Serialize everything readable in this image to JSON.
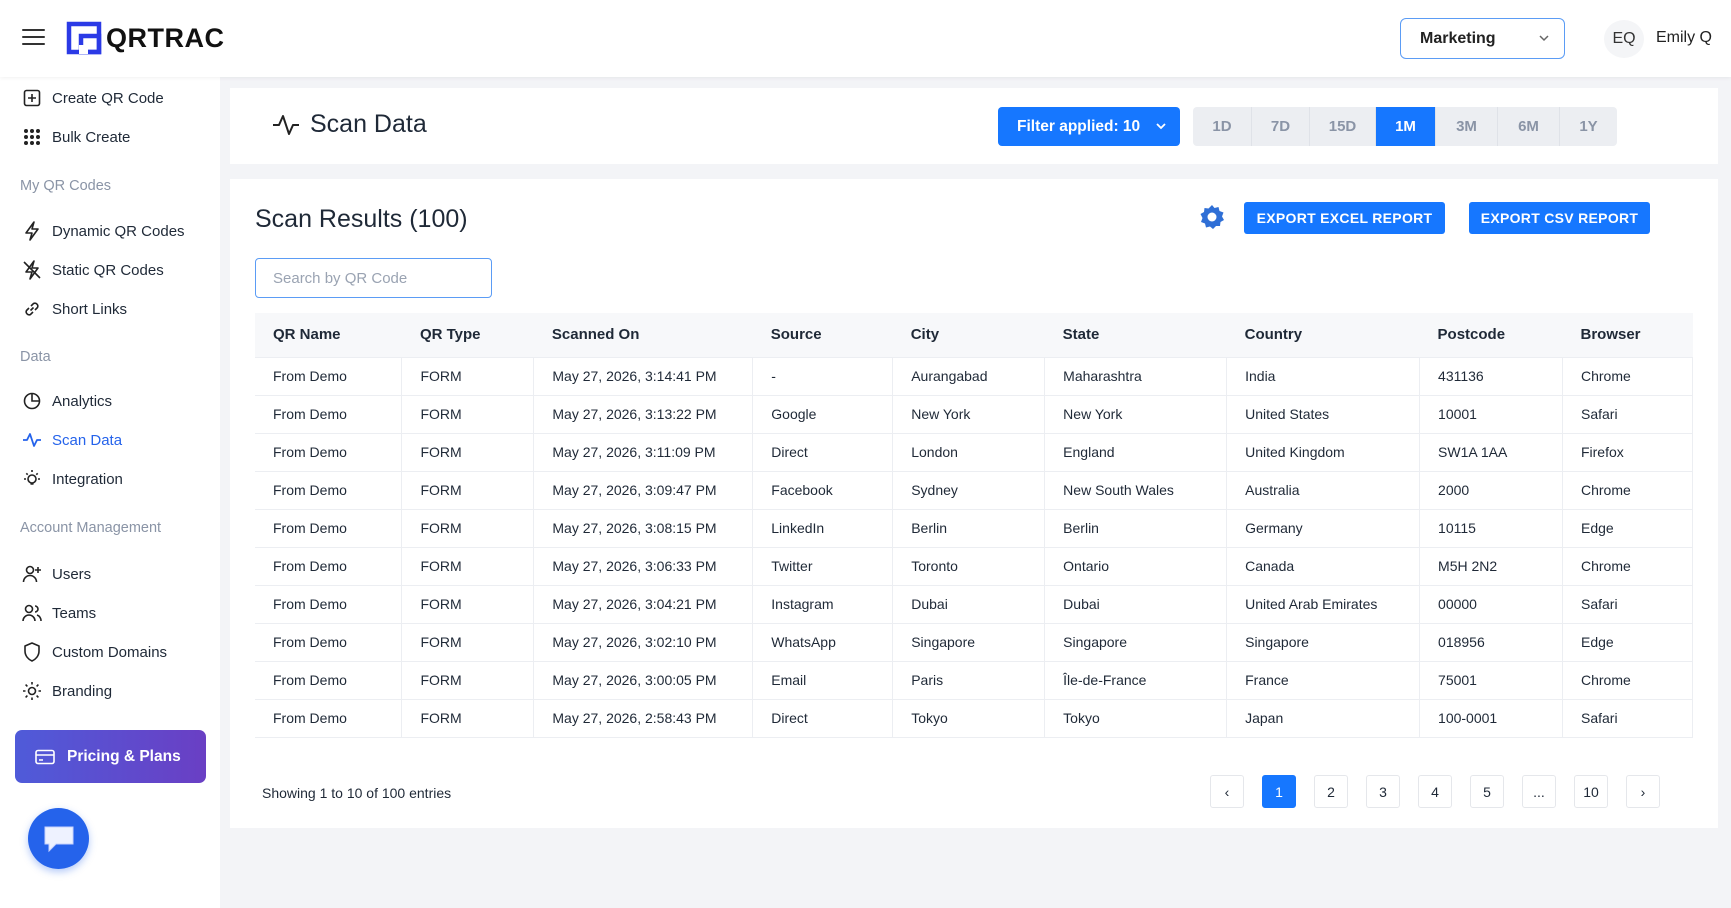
{
  "header": {
    "brand": "QRTRAC",
    "team": "Marketing",
    "avatar_initials": "EQ",
    "user_name": "Emily Q"
  },
  "sidebar": {
    "top_items": [
      {
        "label": "Create QR Code",
        "icon": "plus-square-icon"
      },
      {
        "label": "Bulk Create",
        "icon": "grid-dots-icon"
      }
    ],
    "sections": [
      {
        "label": "My QR Codes",
        "items": [
          {
            "label": "Dynamic QR Codes",
            "icon": "bolt-icon"
          },
          {
            "label": "Static QR Codes",
            "icon": "bolt-off-icon"
          },
          {
            "label": "Short Links",
            "icon": "link-icon"
          }
        ]
      },
      {
        "label": "Data",
        "items": [
          {
            "label": "Analytics",
            "icon": "pie-chart-icon"
          },
          {
            "label": "Scan Data",
            "icon": "activity-icon",
            "active": true
          },
          {
            "label": "Integration",
            "icon": "bulb-icon"
          }
        ]
      },
      {
        "label": "Account Management",
        "items": [
          {
            "label": "Users",
            "icon": "user-plus-icon"
          },
          {
            "label": "Teams",
            "icon": "users-icon"
          },
          {
            "label": "Custom Domains",
            "icon": "shield-icon"
          },
          {
            "label": "Branding",
            "icon": "sun-icon"
          }
        ]
      }
    ],
    "pricing_label": "Pricing & Plans"
  },
  "scan_header": {
    "title": "Scan Data",
    "filter_label": "Filter applied: 10",
    "ranges": [
      "1D",
      "7D",
      "15D",
      "1M",
      "3M",
      "6M",
      "1Y"
    ],
    "active_range": "1M"
  },
  "results": {
    "title": "Scan Results (100)",
    "export_excel": "EXPORT EXCEL REPORT",
    "export_csv": "EXPORT CSV REPORT",
    "search_placeholder": "Search by QR Code",
    "columns": [
      "QR Name",
      "QR Type",
      "Scanned On",
      "Source",
      "City",
      "State",
      "Country",
      "Postcode",
      "Browser"
    ],
    "rows": [
      [
        "From Demo",
        "FORM",
        "May 27, 2026, 3:14:41 PM",
        "-",
        "Aurangabad",
        "Maharashtra",
        "India",
        "431136",
        "Chrome"
      ],
      [
        "From Demo",
        "FORM",
        "May 27, 2026, 3:13:22 PM",
        "Google",
        "New York",
        "New York",
        "United States",
        "10001",
        "Safari"
      ],
      [
        "From Demo",
        "FORM",
        "May 27, 2026, 3:11:09 PM",
        "Direct",
        "London",
        "England",
        "United Kingdom",
        "SW1A 1AA",
        "Firefox"
      ],
      [
        "From Demo",
        "FORM",
        "May 27, 2026, 3:09:47 PM",
        "Facebook",
        "Sydney",
        "New South Wales",
        "Australia",
        "2000",
        "Chrome"
      ],
      [
        "From Demo",
        "FORM",
        "May 27, 2026, 3:08:15 PM",
        "LinkedIn",
        "Berlin",
        "Berlin",
        "Germany",
        "10115",
        "Edge"
      ],
      [
        "From Demo",
        "FORM",
        "May 27, 2026, 3:06:33 PM",
        "Twitter",
        "Toronto",
        "Ontario",
        "Canada",
        "M5H 2N2",
        "Chrome"
      ],
      [
        "From Demo",
        "FORM",
        "May 27, 2026, 3:04:21 PM",
        "Instagram",
        "Dubai",
        "Dubai",
        "United Arab Emirates",
        "00000",
        "Safari"
      ],
      [
        "From Demo",
        "FORM",
        "May 27, 2026, 3:02:10 PM",
        "WhatsApp",
        "Singapore",
        "Singapore",
        "Singapore",
        "018956",
        "Edge"
      ],
      [
        "From Demo",
        "FORM",
        "May 27, 2026, 3:00:05 PM",
        "Email",
        "Paris",
        "Île-de-France",
        "France",
        "75001",
        "Chrome"
      ],
      [
        "From Demo",
        "FORM",
        "May 27, 2026, 2:58:43 PM",
        "Direct",
        "Tokyo",
        "Tokyo",
        "Japan",
        "100-0001",
        "Safari"
      ]
    ],
    "showing": "Showing 1 to 10 of 100 entries",
    "pagination": {
      "prev": "‹",
      "pages": [
        "1",
        "2",
        "3",
        "4",
        "5",
        "...",
        "10"
      ],
      "active": "1",
      "next": "›"
    }
  },
  "colors": {
    "primary": "#1677ff",
    "active_nav": "#2563eb",
    "pricing_gradient_start": "#4f5bd9",
    "pricing_gradient_end": "#6a3fc4"
  }
}
